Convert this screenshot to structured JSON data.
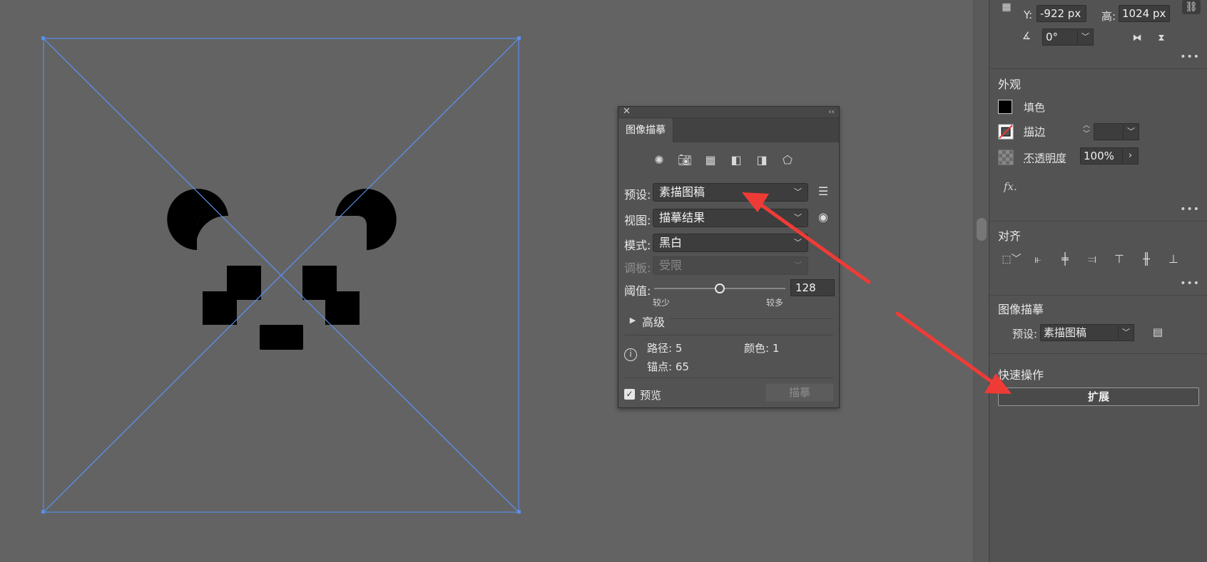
{
  "canvas": {
    "shapes_fill": "#000000",
    "guide_color": "#5b8ee8"
  },
  "right_panel": {
    "transform": {
      "y_label": "Y:",
      "y_value": "-922 px",
      "h_label": "高:",
      "h_value": "1024 px",
      "angle_value": "0°"
    },
    "appearance": {
      "title": "外观",
      "fill_label": "填色",
      "stroke_label": "描边",
      "opacity_label": "不透明度",
      "opacity_value": "100%",
      "fx_label": "fx."
    },
    "align": {
      "title": "对齐"
    },
    "image_trace": {
      "title": "图像描摹",
      "preset_label": "预设:",
      "preset_value": "素描图稿"
    },
    "quick_actions": {
      "title": "快速操作",
      "expand_label": "扩展"
    },
    "more_label": "•••"
  },
  "trace_panel": {
    "tab_label": "图像描摹",
    "preset_label": "预设:",
    "preset_value": "素描图稿",
    "view_label": "视图:",
    "view_value": "描摹结果",
    "mode_label": "模式:",
    "mode_value": "黑白",
    "palette_label": "调板:",
    "palette_value": "受限",
    "threshold_label": "阈值:",
    "threshold_value": "128",
    "threshold_fraction": 0.5,
    "less_label": "较少",
    "more_label": "较多",
    "advanced_label": "高级",
    "paths_label": "路径: 5",
    "colors_label": "颜色: 1",
    "anchors_label": "锚点: 65",
    "preview_label": "预览",
    "trace_button_label": "描摹"
  },
  "annotations": {
    "arrow_color": "#ef3b36"
  }
}
